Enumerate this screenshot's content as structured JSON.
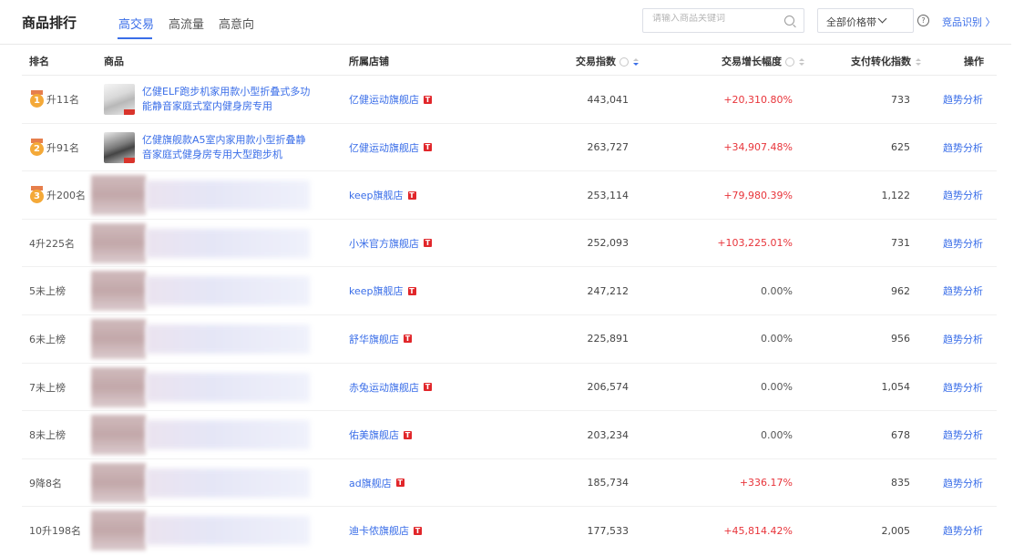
{
  "header": {
    "title": "商品排行",
    "tabs": [
      {
        "label": "高交易",
        "active": true
      },
      {
        "label": "高流量",
        "active": false
      },
      {
        "label": "高意向",
        "active": false
      }
    ],
    "search_placeholder": "请输入商品关键词",
    "price_filter": "全部价格带",
    "help_glyph": "?",
    "competitor_link": "竞品识别 〉"
  },
  "table": {
    "columns": {
      "rank": "排名",
      "product": "商品",
      "shop": "所属店铺",
      "trade_index": "交易指数",
      "growth": "交易增长幅度",
      "conversion": "支付转化指数",
      "action": "操作"
    },
    "tmall_badge": "T",
    "rows": [
      {
        "medal": "1",
        "rank": "升11名",
        "product": "亿健ELF跑步机家用款小型折叠式多功能静音家庭式室内健身房专用",
        "shop": "亿健运动旗舰店",
        "trade_index": "443,041",
        "growth": "+20,310.80%",
        "conversion": "733",
        "action": "趋势分析"
      },
      {
        "medal": "2",
        "rank": "升91名",
        "product": "亿健旗舰款A5室内家用款小型折叠静音家庭式健身房专用大型跑步机",
        "shop": "亿健运动旗舰店",
        "trade_index": "263,727",
        "growth": "+34,907.48%",
        "conversion": "625",
        "action": "趋势分析"
      },
      {
        "medal": "3",
        "rank": "升200名",
        "product": "",
        "shop": "keep旗舰店",
        "trade_index": "253,114",
        "growth": "+79,980.39%",
        "conversion": "1,122",
        "action": "趋势分析"
      },
      {
        "medal": "",
        "rank": "4升225名",
        "product": "",
        "shop": "小米官方旗舰店",
        "trade_index": "252,093",
        "growth": "+103,225.01%",
        "conversion": "731",
        "action": "趋势分析"
      },
      {
        "medal": "",
        "rank": "5未上榜",
        "product": "",
        "shop": "keep旗舰店",
        "trade_index": "247,212",
        "growth": "0.00%",
        "conversion": "962",
        "action": "趋势分析"
      },
      {
        "medal": "",
        "rank": "6未上榜",
        "product": "",
        "shop": "舒华旗舰店",
        "trade_index": "225,891",
        "growth": "0.00%",
        "conversion": "956",
        "action": "趋势分析"
      },
      {
        "medal": "",
        "rank": "7未上榜",
        "product": "",
        "shop": "赤兔运动旗舰店",
        "trade_index": "206,574",
        "growth": "0.00%",
        "conversion": "1,054",
        "action": "趋势分析"
      },
      {
        "medal": "",
        "rank": "8未上榜",
        "product": "",
        "shop": "佑美旗舰店",
        "trade_index": "203,234",
        "growth": "0.00%",
        "conversion": "678",
        "action": "趋势分析"
      },
      {
        "medal": "",
        "rank": "9降8名",
        "product": "",
        "shop": "ad旗舰店",
        "trade_index": "185,734",
        "growth": "+336.17%",
        "conversion": "835",
        "action": "趋势分析"
      },
      {
        "medal": "",
        "rank": "10升198名",
        "product": "",
        "shop": "迪卡侬旗舰店",
        "trade_index": "177,533",
        "growth": "+45,814.42%",
        "conversion": "2,005",
        "action": "趋势分析"
      }
    ]
  },
  "colors": {
    "accent": "#3a6ee8",
    "positive": "#e8343a",
    "medal": "#f4a938",
    "tmall": "#e1262a"
  }
}
